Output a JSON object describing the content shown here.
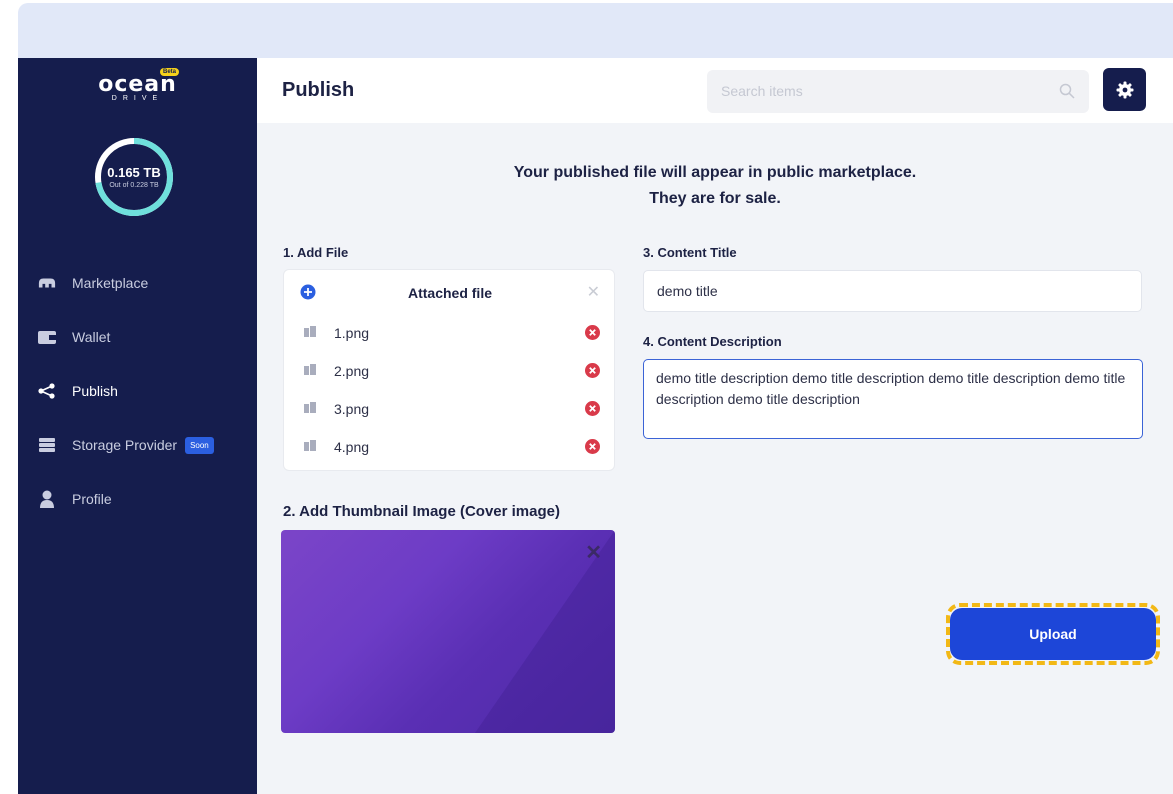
{
  "app": {
    "logo_text": "ocean",
    "logo_sub": "DRIVE",
    "logo_badge": "Beta"
  },
  "storage": {
    "used": "0.165 TB",
    "total": "Out of 0.228 TB",
    "used_fraction": 0.724,
    "ring_color": "#6fe0dc"
  },
  "sidebar": {
    "items": [
      {
        "label": "Marketplace",
        "icon": "marketplace-icon"
      },
      {
        "label": "Wallet",
        "icon": "wallet-icon"
      },
      {
        "label": "Publish",
        "icon": "share-icon",
        "active": true
      },
      {
        "label": "Storage Provider",
        "icon": "storage-icon",
        "badge": "Soon"
      },
      {
        "label": "Profile",
        "icon": "user-icon"
      }
    ]
  },
  "header": {
    "title": "Publish",
    "search_placeholder": "Search items"
  },
  "notice": {
    "line1": "Your published file will appear in public marketplace.",
    "line2": "They are for sale."
  },
  "files": {
    "section_label": "1. Add File",
    "card_title": "Attached file",
    "items": [
      "1.png",
      "2.png",
      "3.png",
      "4.png"
    ]
  },
  "thumbnail": {
    "section_label": "2. Add Thumbnail Image (Cover image)"
  },
  "content_title": {
    "section_label": "3. Content Title",
    "value": "demo title"
  },
  "content_description": {
    "section_label": "4. Content Description",
    "value": "demo title description demo title description demo title description demo title description demo title description"
  },
  "actions": {
    "upload_label": "Upload"
  },
  "colors": {
    "sidebar": "#151d4d",
    "accent": "#1d46d8",
    "highlight": "#f2b816"
  }
}
